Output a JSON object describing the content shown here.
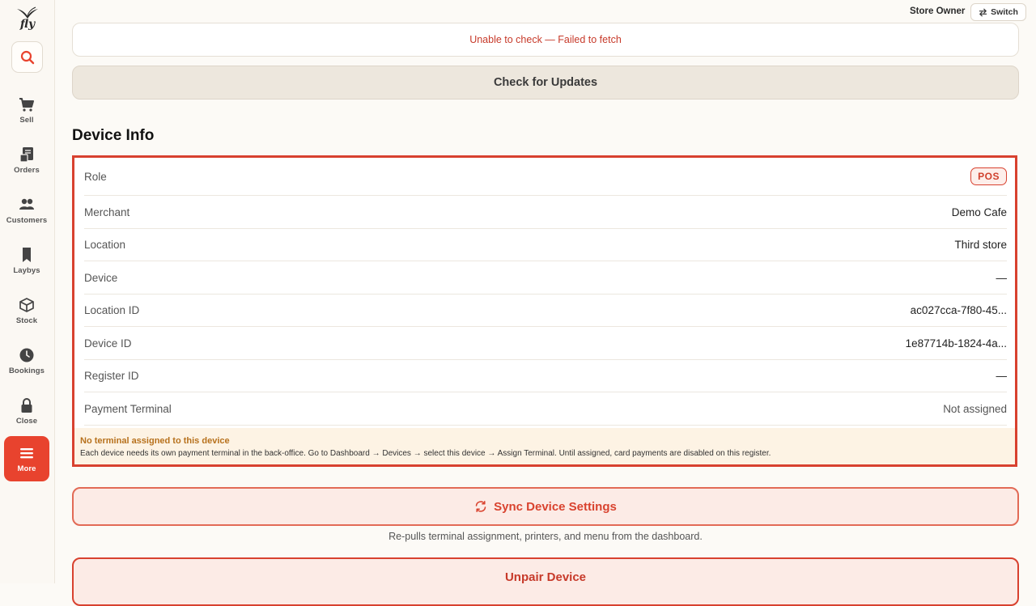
{
  "brand": {
    "logo_text": "fly"
  },
  "sidebar": {
    "items": [
      {
        "label": "Sell",
        "icon": "cart-icon"
      },
      {
        "label": "Orders",
        "icon": "receipt-icon"
      },
      {
        "label": "Customers",
        "icon": "users-icon"
      },
      {
        "label": "Laybys",
        "icon": "bookmark-icon"
      },
      {
        "label": "Stock",
        "icon": "box-icon"
      },
      {
        "label": "Bookings",
        "icon": "clock-icon"
      },
      {
        "label": "Close",
        "icon": "lock-icon"
      },
      {
        "label": "More",
        "icon": "menu-icon",
        "active": true
      }
    ]
  },
  "topbar": {
    "owner_label": "Store Owner",
    "switch_label": "Switch"
  },
  "update": {
    "status_text": "Unable to check — Failed to fetch",
    "check_button": "Check for Updates"
  },
  "device_info": {
    "title": "Device Info",
    "rows": [
      {
        "label": "Role",
        "value": "POS"
      },
      {
        "label": "Merchant",
        "value": "Demo Cafe"
      },
      {
        "label": "Location",
        "value": "Third store"
      },
      {
        "label": "Device",
        "value": "—"
      },
      {
        "label": "Location ID",
        "value": "ac027cca-7f80-45..."
      },
      {
        "label": "Device ID",
        "value": "1e87714b-1824-4a..."
      },
      {
        "label": "Register ID",
        "value": "—"
      },
      {
        "label": "Payment Terminal",
        "value": "Not assigned"
      }
    ],
    "warning_title": "No terminal assigned to this device",
    "warning_body": "Each device needs its own payment terminal in the back-office. Go to Dashboard → Devices → select this device → Assign Terminal. Until assigned, card payments are disabled on this register."
  },
  "actions": {
    "sync_label": "Sync Device Settings",
    "sync_note": "Re-pulls terminal assignment, printers, and menu from the dashboard.",
    "unpair_label": "Unpair Device"
  },
  "colors": {
    "accent": "#e8432e",
    "warning_text": "#b7711c",
    "error_text": "#c73a2a"
  }
}
